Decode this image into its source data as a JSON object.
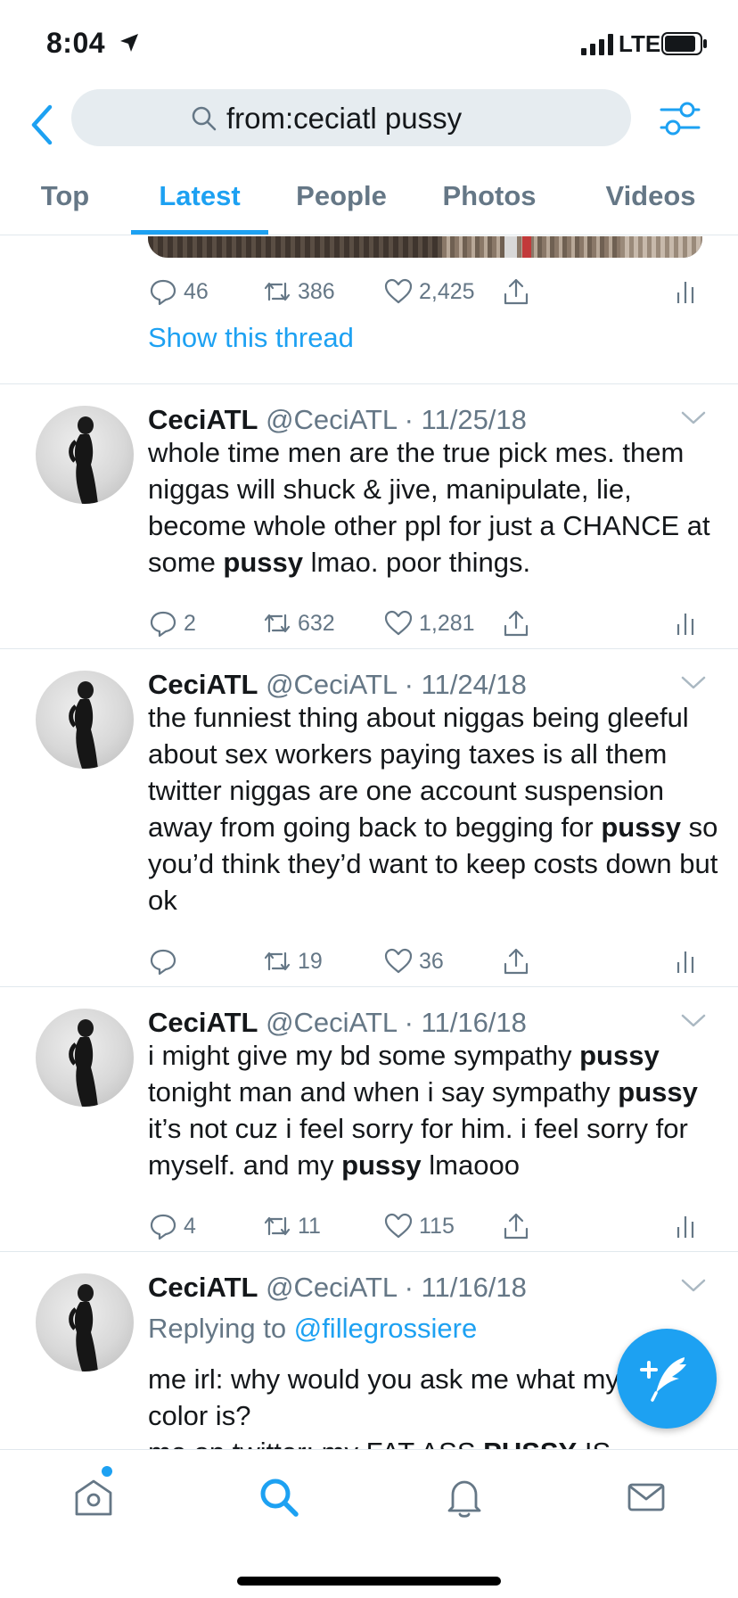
{
  "status_bar": {
    "time": "8:04",
    "network": "LTE"
  },
  "search": {
    "query": "from:ceciatl pussy"
  },
  "tabs": [
    {
      "label": "Top"
    },
    {
      "label": "Latest"
    },
    {
      "label": "People"
    },
    {
      "label": "Photos"
    },
    {
      "label": "Videos"
    }
  ],
  "active_tab": "Latest",
  "previous_tweet": {
    "replies": "46",
    "retweets": "386",
    "likes": "2,425",
    "show_thread": "Show this thread"
  },
  "tweets": [
    {
      "name": "CeciATL",
      "handle": "@CeciATL",
      "date": "11/25/18",
      "text_parts": [
        "whole time men are the true pick mes. them niggas will shuck & jive, manipulate, lie, become whole other ppl for just a CHANCE at some ",
        "pussy",
        " lmao. poor things."
      ],
      "replies": "2",
      "retweets": "632",
      "likes": "1,281"
    },
    {
      "name": "CeciATL",
      "handle": "@CeciATL",
      "date": "11/24/18",
      "text_parts": [
        "the funniest thing about niggas being gleeful about sex workers paying taxes is all them twitter niggas are one account suspension away from going back to begging for ",
        "pussy",
        " so you’d think they’d want to keep costs down but ok"
      ],
      "replies": "",
      "retweets": "19",
      "likes": "36"
    },
    {
      "name": "CeciATL",
      "handle": "@CeciATL",
      "date": "11/16/18",
      "text_parts": [
        "i might give my bd some sympathy ",
        "pussy",
        " tonight man and when i say sympathy ",
        "pussy",
        " it’s not cuz i feel sorry for him. i feel sorry for myself. and my ",
        "pussy",
        " lmaooo"
      ],
      "replies": "4",
      "retweets": "11",
      "likes": "115"
    },
    {
      "name": "CeciATL",
      "handle": "@CeciATL",
      "date": "11/16/18",
      "replying_prefix": "Replying to ",
      "replying_to": "@fillegrossiere",
      "text_parts": [
        "me irl: why would you ask me what my favorite color is?\nme on twitter: my FAT ASS ",
        "PUSSY",
        " IS"
      ]
    }
  ],
  "colors": {
    "accent": "#1da1f2",
    "secondary_text": "#657786",
    "divider": "#e1e8ed",
    "search_bg": "#e6ecf0"
  },
  "icons": [
    "location-arrow-icon",
    "signal-icon",
    "battery-icon",
    "back-chevron-icon",
    "search-icon",
    "filter-icon",
    "reply-icon",
    "retweet-icon",
    "like-icon",
    "share-icon",
    "stats-icon",
    "chevron-down-icon",
    "compose-icon",
    "home-icon",
    "explore-search-icon",
    "notifications-icon",
    "messages-icon"
  ]
}
